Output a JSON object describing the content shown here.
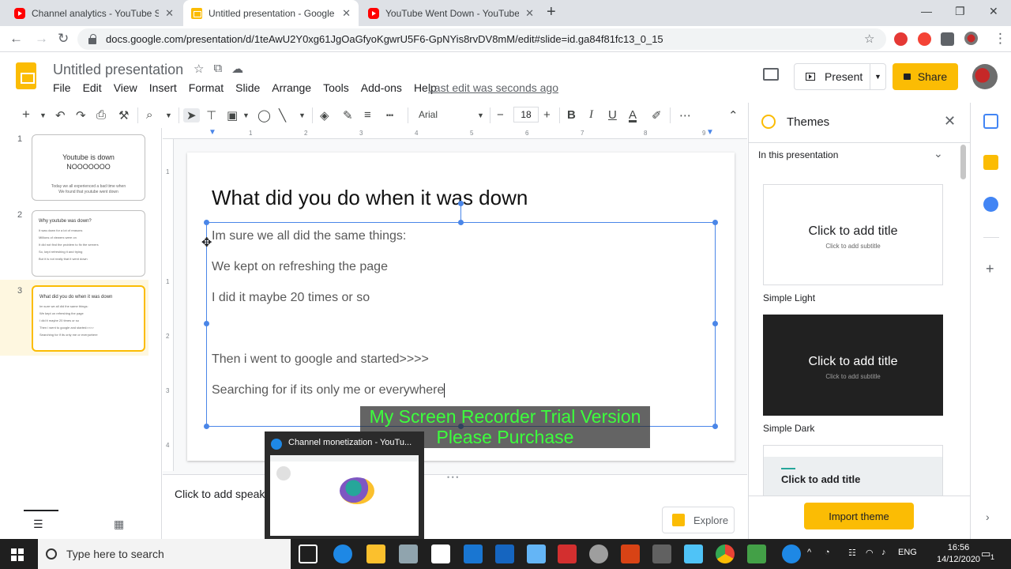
{
  "browser": {
    "tabs": [
      {
        "title": "Channel analytics - YouTube Stud",
        "type": "youtube"
      },
      {
        "title": "Untitled presentation - Google S",
        "type": "slides"
      },
      {
        "title": "YouTube Went Down - YouTube",
        "type": "youtube"
      }
    ],
    "url": "docs.google.com/presentation/d/1teAwU2Y0xg61JgOaGfyoKgwrU5F6-GpNYis8rvDV8mM/edit#slide=id.ga84f81fc13_0_15"
  },
  "header": {
    "title": "Untitled presentation",
    "menu": [
      "File",
      "Edit",
      "View",
      "Insert",
      "Format",
      "Slide",
      "Arrange",
      "Tools",
      "Add-ons",
      "Help"
    ],
    "last_edit": "Last edit was seconds ago",
    "present_label": "Present",
    "share_label": "Share"
  },
  "toolbar": {
    "font": "Arial",
    "font_size": "18",
    "minus": "−",
    "plus": "+",
    "bold": "B",
    "italic": "I",
    "underline": "U",
    "text_color": "A",
    "more": "⋯",
    "collapse": "⌃"
  },
  "filmstrip": [
    {
      "num": "1",
      "title": "Youtube is down\nNOOOOOOO",
      "sub": "Today we all experienced a bad time when\nWe found that youtube went down"
    },
    {
      "num": "2",
      "heading": "Why youtube was down?",
      "lines": [
        "It was down for a lot of reasons",
        "Millions of viewers were on",
        "It did not find the problem to fix the servers",
        "So, kept refreshing it and trying",
        "But it is not really that it went down"
      ]
    },
    {
      "num": "3",
      "heading": "What did you do when it was down",
      "lines": [
        "Im sure we all did the same things:",
        "We kept on refreshing the page",
        "I did it maybe 20 times or so",
        "",
        "Then i went to google and started>>>>",
        "Searching for if its only me or everywhere"
      ]
    }
  ],
  "ruler": {
    "h": [
      "1",
      "2",
      "3",
      "4",
      "5",
      "6",
      "7",
      "8",
      "9"
    ],
    "v": [
      "1",
      "1",
      "2",
      "3",
      "4"
    ]
  },
  "slide": {
    "title": "What did you do when it was down",
    "lines": [
      "Im sure we all did the same things:",
      "We kept on refreshing the page",
      "I did it maybe 20 times or so",
      "Then i went to google and started>>>>",
      "Searching for if its only me or everywhere"
    ]
  },
  "watermark": {
    "line1": "My Screen Recorder Trial Version",
    "line2": "Please Purchase"
  },
  "notes": {
    "placeholder": "Click to add speake"
  },
  "explore_label": "Explore",
  "popup": {
    "title": "Channel monetization - YouTu..."
  },
  "themes": {
    "heading": "Themes",
    "section": "In this presentation",
    "cards": [
      {
        "name": "Simple Light",
        "title": "Click to add title",
        "subtitle": "Click to add subtitle"
      },
      {
        "name": "Simple Dark",
        "title": "Click to add title",
        "subtitle": "Click to add subtitle"
      },
      {
        "name": "",
        "title": "Click to add title",
        "subtitle": ""
      }
    ],
    "import_label": "Import theme"
  },
  "taskbar": {
    "search_placeholder": "Type here to search",
    "lang": "ENG",
    "time": "16:56",
    "date": "14/12/2020",
    "notif_count": "1"
  },
  "colors": {
    "accent": "#fbbc04",
    "selection": "#4a86e8",
    "watermark_text": "#3cff3c",
    "youtube": "#ff0000"
  }
}
